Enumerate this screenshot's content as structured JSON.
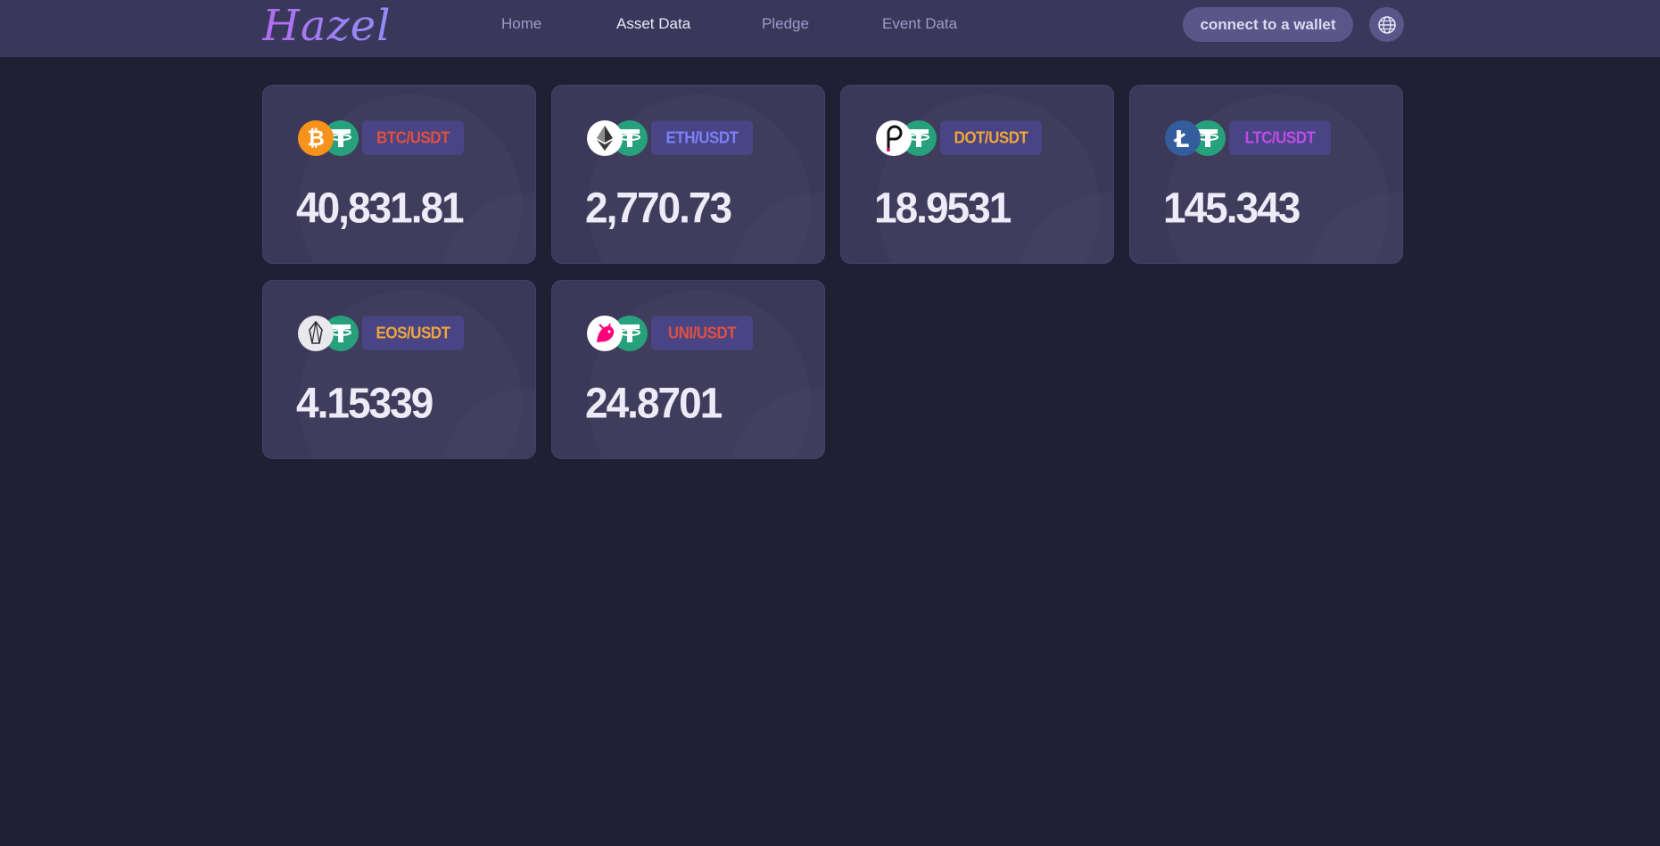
{
  "header": {
    "logo": "Hazel",
    "nav": [
      {
        "label": "Home",
        "active": false
      },
      {
        "label": "Asset Data",
        "active": true
      },
      {
        "label": "Pledge",
        "active": false
      },
      {
        "label": "Event Data",
        "active": false
      }
    ],
    "wallet_button": "connect to a wallet",
    "language_icon": "globe-icon"
  },
  "cards": [
    {
      "pair": "BTC/USDT",
      "price": "40,831.81",
      "pair_color": "#e0503f",
      "base_icon": "bitcoin-icon",
      "quote_icon": "tether-icon"
    },
    {
      "pair": "ETH/USDT",
      "price": "2,770.73",
      "pair_color": "#7d7ff8",
      "base_icon": "ethereum-icon",
      "quote_icon": "tether-icon"
    },
    {
      "pair": "DOT/USDT",
      "price": "18.9531",
      "pair_color": "#f0a53a",
      "base_icon": "polkadot-icon",
      "quote_icon": "tether-icon"
    },
    {
      "pair": "LTC/USDT",
      "price": "145.343",
      "pair_color": "#c04be8",
      "base_icon": "litecoin-icon",
      "quote_icon": "tether-icon"
    },
    {
      "pair": "EOS/USDT",
      "price": "4.15339",
      "pair_color": "#f0a53a",
      "base_icon": "eos-icon",
      "quote_icon": "tether-icon"
    },
    {
      "pair": "UNI/USDT",
      "price": "24.8701",
      "pair_color": "#e0503f",
      "base_icon": "uniswap-icon",
      "quote_icon": "tether-icon"
    }
  ],
  "colors": {
    "background": "#201f33",
    "header": "#3a385a",
    "card": "#3b3859",
    "tether": "#26a17b",
    "bitcoin": "#f7931a",
    "litecoin": "#345d9d",
    "uniswap": "#ff007a"
  }
}
